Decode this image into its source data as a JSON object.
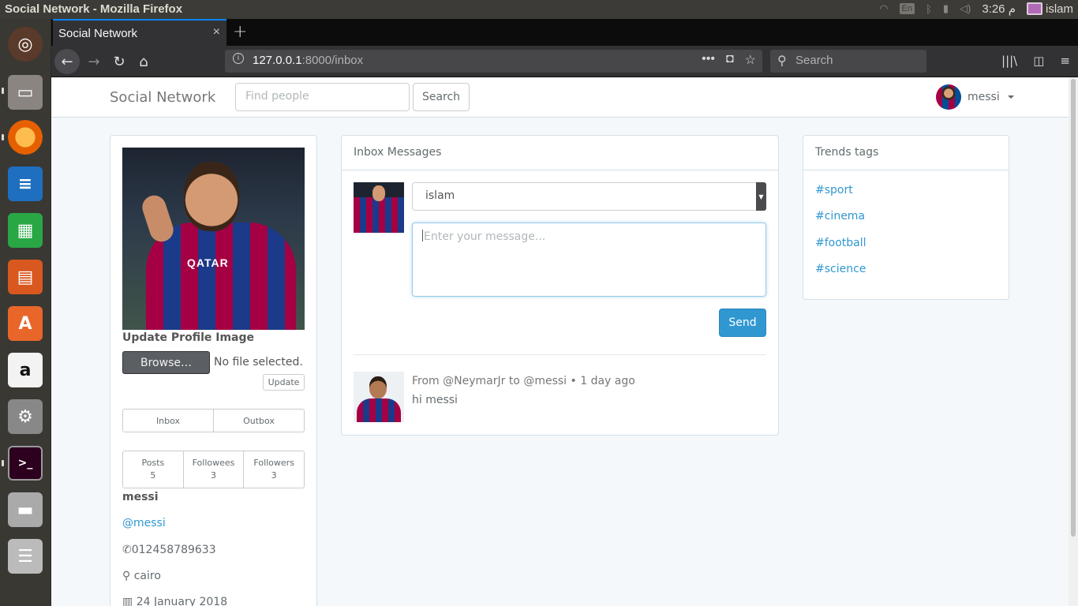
{
  "os": {
    "window_title": "Social Network - Mozilla Firefox",
    "keyboard": "En",
    "clock": "3:26 م",
    "user": "islam"
  },
  "browser": {
    "tab_title": "Social Network",
    "tab_close": "×",
    "new_tab": "+",
    "url_host": "127.0.0.1",
    "url_rest": ":8000/inbox",
    "search_placeholder": "Search"
  },
  "site": {
    "brand": "Social Network",
    "find_placeholder": "Find people",
    "find_button": "Search",
    "current_user": "messi"
  },
  "profile": {
    "update_image_label": "Update Profile Image",
    "browse_button": "Browse…",
    "no_file": "No file selected.",
    "update_button": "Update",
    "inbox_button": "Inbox",
    "outbox_button": "Outbox",
    "stats": [
      {
        "label": "Posts",
        "value": "5"
      },
      {
        "label": "Followees",
        "value": "3"
      },
      {
        "label": "Followers",
        "value": "3"
      }
    ],
    "name": "messi",
    "handle": "@messi",
    "phone": "012458789633",
    "city": "cairo",
    "joined": "24 January 2018",
    "jersey_sponsor": "QATAR"
  },
  "inbox": {
    "heading": "Inbox Messages",
    "recipient": "islam",
    "message_placeholder": "Enter your message...",
    "send_button": "Send",
    "messages": [
      {
        "meta": "From @NeymarJr to @messi • 1 day ago",
        "body": "hi messi"
      }
    ]
  },
  "trends": {
    "heading": "Trends tags",
    "tags": [
      "#sport",
      "#cinema",
      "#football",
      "#science"
    ]
  },
  "colors": {
    "link": "#3097d1",
    "primary": "#3097d1",
    "page_bg": "#f5f8fa"
  }
}
